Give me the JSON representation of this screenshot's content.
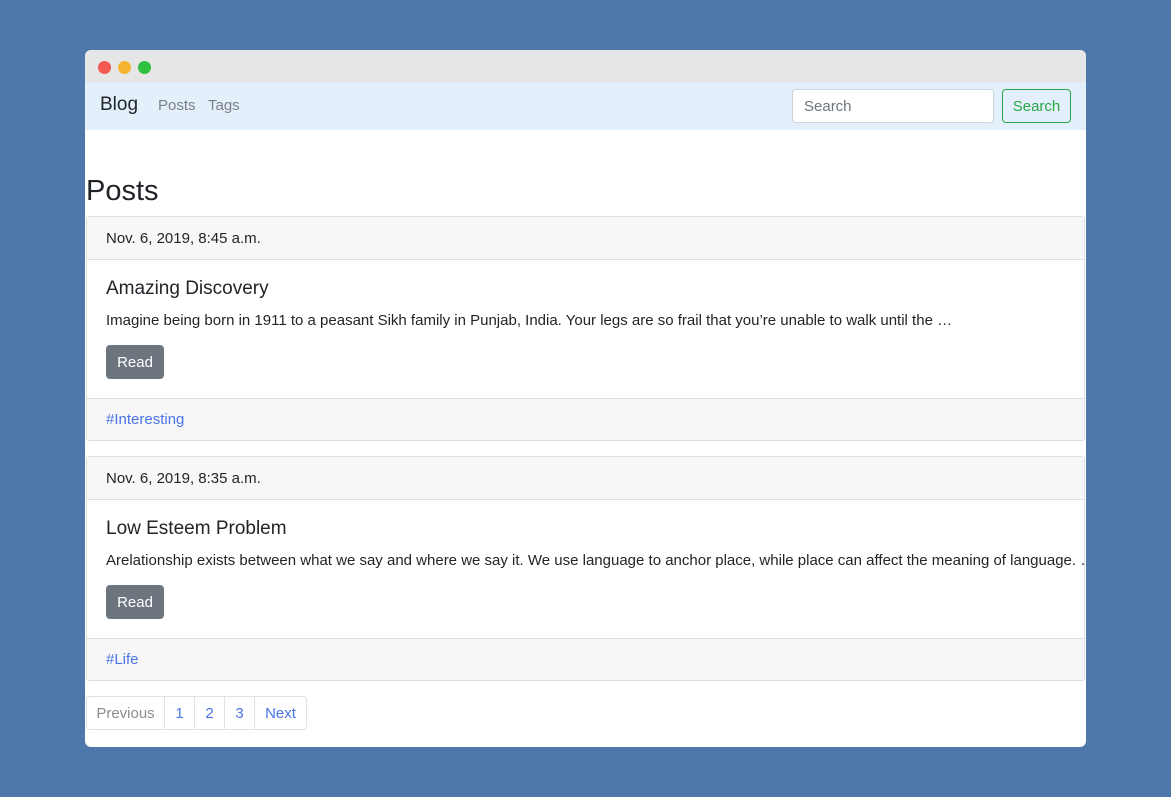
{
  "window": {
    "controls": [
      "close",
      "minimize",
      "maximize"
    ]
  },
  "navbar": {
    "brand": "Blog",
    "links": [
      "Posts",
      "Tags"
    ],
    "search_placeholder": "Search",
    "search_button": "Search"
  },
  "page": {
    "title": "Posts"
  },
  "posts": [
    {
      "date": "Nov. 6, 2019, 8:45 a.m.",
      "title": "Amazing Discovery",
      "excerpt": "Imagine being born in 1911 to a peasant Sikh family in Punjab, India. Your legs are so frail that you’re unable to walk until the …",
      "read_label": "Read",
      "tag": "#Interesting"
    },
    {
      "date": "Nov. 6, 2019, 8:35 a.m.",
      "title": "Low Esteem Problem",
      "excerpt": "Arelationship exists between what we say and where we say it. We use language to anchor place, while place can affect the meaning of language. …",
      "read_label": "Read",
      "tag": "#Life"
    }
  ],
  "pagination": {
    "previous": "Previous",
    "pages": [
      "1",
      "2",
      "3"
    ],
    "next": "Next"
  },
  "colors": {
    "background": "#4e77aa",
    "navbar": "#e3f0fc",
    "search_accent": "#28a745",
    "link": "#4a74e8",
    "read_button": "#6c757d"
  }
}
